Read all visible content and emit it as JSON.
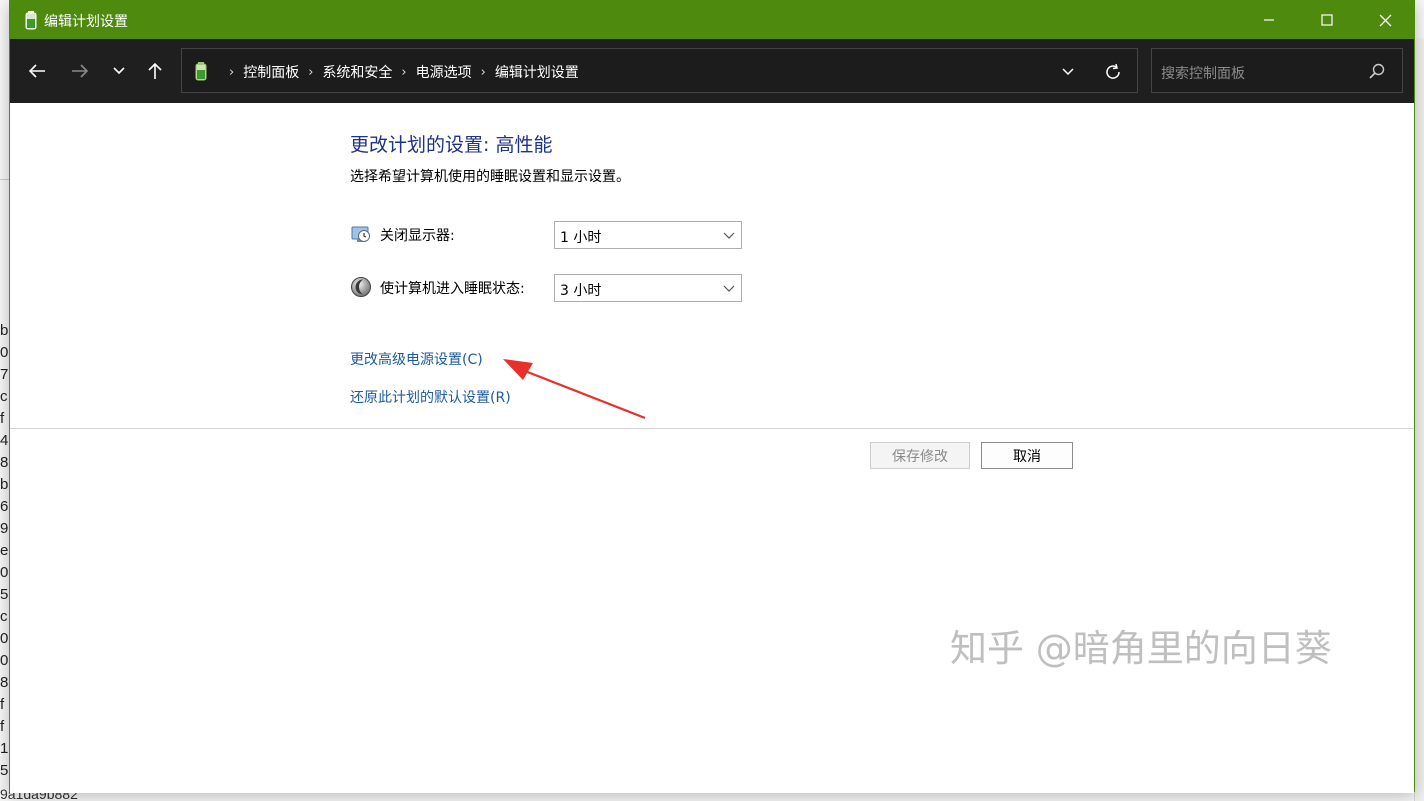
{
  "window": {
    "title": "编辑计划设置"
  },
  "nav": {
    "breadcrumbs": [
      "控制面板",
      "系统和安全",
      "电源选项",
      "编辑计划设置"
    ],
    "search_placeholder": "搜索控制面板"
  },
  "content": {
    "title": "更改计划的设置: 高性能",
    "description": "选择希望计算机使用的睡眠设置和显示设置。",
    "settings": [
      {
        "label": "关闭显示器:",
        "value": "1 小时",
        "icon": "monitor-power-icon"
      },
      {
        "label": "使计算机进入睡眠状态:",
        "value": "3 小时",
        "icon": "sleep-moon-icon"
      }
    ],
    "links": {
      "advanced": "更改高级电源设置(C)",
      "restore": "还原此计划的默认设置(R)"
    },
    "buttons": {
      "save": "保存修改",
      "cancel": "取消"
    }
  },
  "background": {
    "side_text": "b\n0\n7\nc\nf\n4\n8\nb\n6\n9\ne\n0\n5\nc\n0\n0\n8\nf\nf\n1\n5",
    "bottom_text": "9a1da9b882"
  },
  "watermark": "知乎 @暗角里的向日葵",
  "colors": {
    "titlebar": "#4e8a0e",
    "navbar": "#1f1f1f",
    "title_text": "#1e3287",
    "link": "#1e5a9e",
    "annotation_arrow": "#e8302a"
  }
}
